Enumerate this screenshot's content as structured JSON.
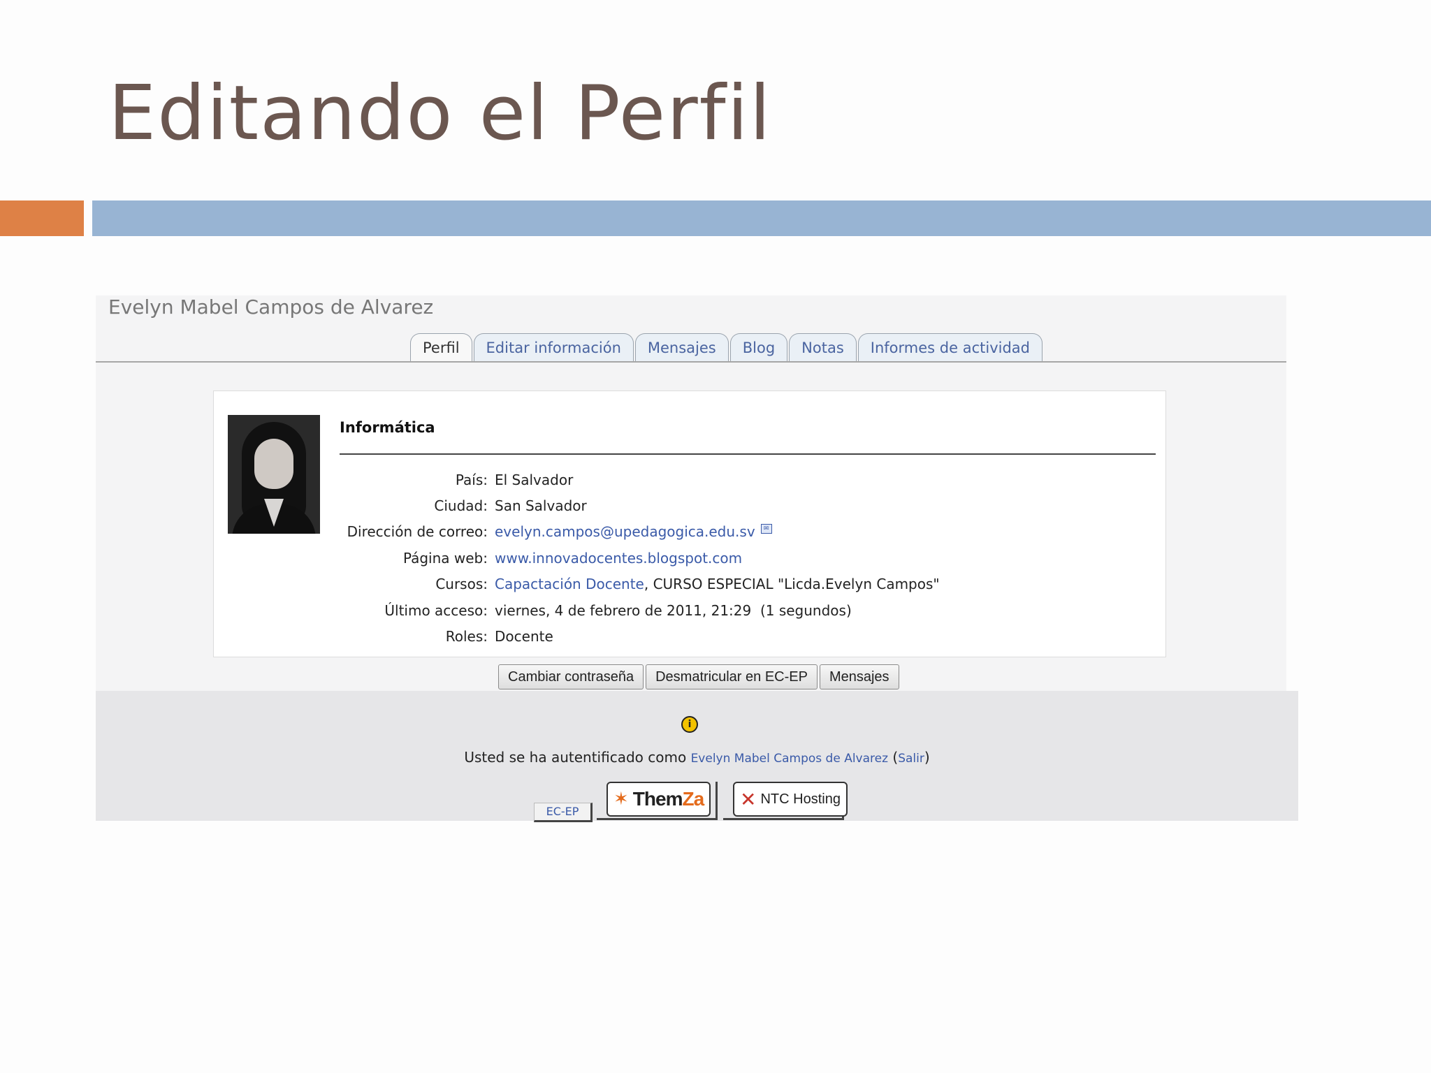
{
  "slide": {
    "title": "Editando el Perfil"
  },
  "profile": {
    "user_name": "Evelyn Mabel Campos de Alvarez",
    "tabs": [
      {
        "label": "Perfil",
        "active": true
      },
      {
        "label": "Editar información"
      },
      {
        "label": "Mensajes"
      },
      {
        "label": "Blog"
      },
      {
        "label": "Notas"
      },
      {
        "label": "Informes de actividad"
      }
    ],
    "department": "Informática",
    "fields": {
      "pais": {
        "label": "País:",
        "value": "El Salvador"
      },
      "ciudad": {
        "label": "Ciudad:",
        "value": "San Salvador"
      },
      "correo": {
        "label": "Dirección de correo:",
        "value": "evelyn.campos@upedagogica.edu.sv"
      },
      "web": {
        "label": "Página web:",
        "value": "www.innovadocentes.blogspot.com"
      },
      "cursos": {
        "label": "Cursos:",
        "course_link": "Capactación Docente",
        "rest": ", CURSO ESPECIAL \"Licda.Evelyn Campos\""
      },
      "acceso": {
        "label": "Último acceso:",
        "value": "viernes, 4 de febrero de 2011, 21:29  (1 segundos)"
      },
      "roles": {
        "label": "Roles:",
        "value": "Docente"
      }
    },
    "buttons": {
      "change_password": "Cambiar contraseña",
      "unenrol": "Desmatricular en EC-EP",
      "messages": "Mensajes"
    }
  },
  "footer": {
    "info_icon": "info-icon",
    "auth_prefix": "Usted se ha autentificado como ",
    "auth_user": "Evelyn Mabel Campos de Alvarez",
    "paren_open": " (",
    "logout": "Salir",
    "paren_close": ")",
    "home_link": "EC-EP",
    "logo1_a": "Them",
    "logo1_b": "Za",
    "logo2": "NTC Hosting"
  },
  "colors": {
    "title": "#6b5750",
    "accent_orange": "#de8146",
    "accent_blue": "#98b4d3",
    "link": "#3a5aa8"
  }
}
